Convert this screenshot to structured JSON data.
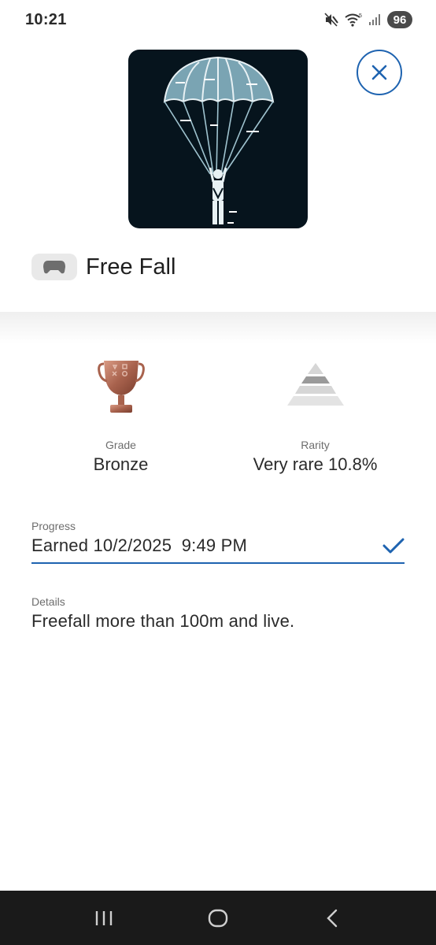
{
  "status_bar": {
    "time": "10:21",
    "battery": "96",
    "icons": [
      "mute-icon",
      "wifi-icon",
      "signal-icon"
    ]
  },
  "trophy": {
    "image": "parachute-trophy-art",
    "name": "Free Fall",
    "platform_icon": "gamepad-icon"
  },
  "stats": {
    "grade_label": "Grade",
    "grade_value": "Bronze",
    "grade_icon": "bronze-trophy-icon",
    "rarity_label": "Rarity",
    "rarity_value": "Very rare 10.8%",
    "rarity_icon": "rarity-pyramid-icon"
  },
  "progress": {
    "label": "Progress",
    "value": "Earned 10/2/2025  9:49 PM",
    "status_icon": "checkmark-icon"
  },
  "details": {
    "label": "Details",
    "value": "Freefall more than 100m and live."
  },
  "colors": {
    "accent": "#1e63b0",
    "bronze": "#b06b55",
    "image_bg": "#06141d",
    "nav_bg": "#1a1a1a"
  }
}
